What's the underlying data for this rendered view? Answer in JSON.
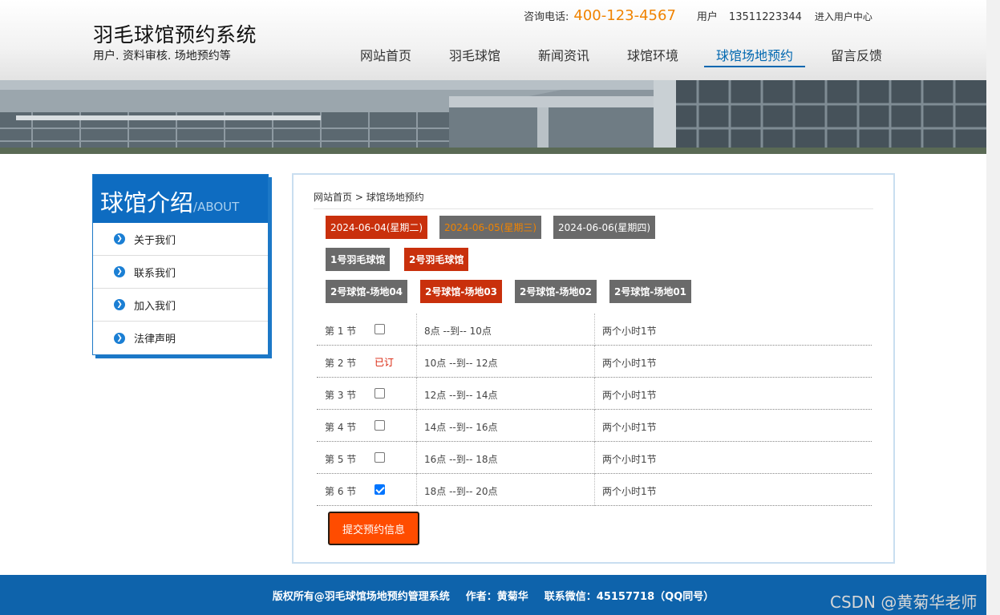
{
  "header": {
    "site_title": "羽毛球馆预约系统",
    "site_subtitle": "用户. 资料审核. 场地预约等",
    "contact_label": "咨询电话:",
    "contact_phone": "400-123-4567",
    "user_label": "用户",
    "user_phone": "13511223344",
    "user_center": "进入用户中心"
  },
  "nav": {
    "items": [
      "网站首页",
      "羽毛球馆",
      "新闻资讯",
      "球馆环境",
      "球馆场地预约",
      "留言反馈"
    ],
    "active": "球馆场地预约"
  },
  "sidebar": {
    "title": "球馆介绍",
    "title_en": "/ABOUT",
    "items": [
      "关于我们",
      "联系我们",
      "加入我们",
      "法律声明"
    ]
  },
  "breadcrumb": {
    "home": "网站首页",
    "separator": ">",
    "current": "球馆场地预约"
  },
  "dates": [
    {
      "label": "2024-06-04(星期二)",
      "state": "selected"
    },
    {
      "label": "2024-06-05(星期三)",
      "state": "today"
    },
    {
      "label": "2024-06-06(星期四)",
      "state": "normal"
    }
  ],
  "venues": [
    {
      "label": "1号羽毛球馆",
      "state": "normal"
    },
    {
      "label": "2号羽毛球馆",
      "state": "selected"
    }
  ],
  "courts": [
    {
      "label": "2号球馆-场地04",
      "state": "normal"
    },
    {
      "label": "2号球馆-场地03",
      "state": "selected"
    },
    {
      "label": "2号球馆-场地02",
      "state": "normal"
    },
    {
      "label": "2号球馆-场地01",
      "state": "normal"
    }
  ],
  "slots": [
    {
      "period": "第 1 节",
      "status": "unchecked",
      "time": "8点 --到-- 10点",
      "note": "两个小时1节"
    },
    {
      "period": "第 2 节",
      "status": "booked",
      "booked_text": "已订",
      "time": "10点 --到-- 12点",
      "note": "两个小时1节"
    },
    {
      "period": "第 3 节",
      "status": "unchecked",
      "time": "12点 --到-- 14点",
      "note": "两个小时1节"
    },
    {
      "period": "第 4 节",
      "status": "unchecked",
      "time": "14点 --到-- 16点",
      "note": "两个小时1节"
    },
    {
      "period": "第 5 节",
      "status": "unchecked",
      "time": "16点 --到-- 18点",
      "note": "两个小时1节"
    },
    {
      "period": "第 6 节",
      "status": "checked",
      "time": "18点 --到-- 20点",
      "note": "两个小时1节"
    }
  ],
  "submit_label": "提交预约信息",
  "footer": {
    "copyright": "版权所有@羽毛球馆场地预约管理系统",
    "author": "作者：黄菊华",
    "wechat": "联系微信：45157718（QQ同号）"
  },
  "watermark": "CSDN @黄菊华老师",
  "colors": {
    "brand_blue": "#0e6cc1",
    "selected_red": "#c9300c",
    "button_gray": "#6a6a6a",
    "accent_orange": "#f08300",
    "submit_orange": "#ff4c00"
  }
}
